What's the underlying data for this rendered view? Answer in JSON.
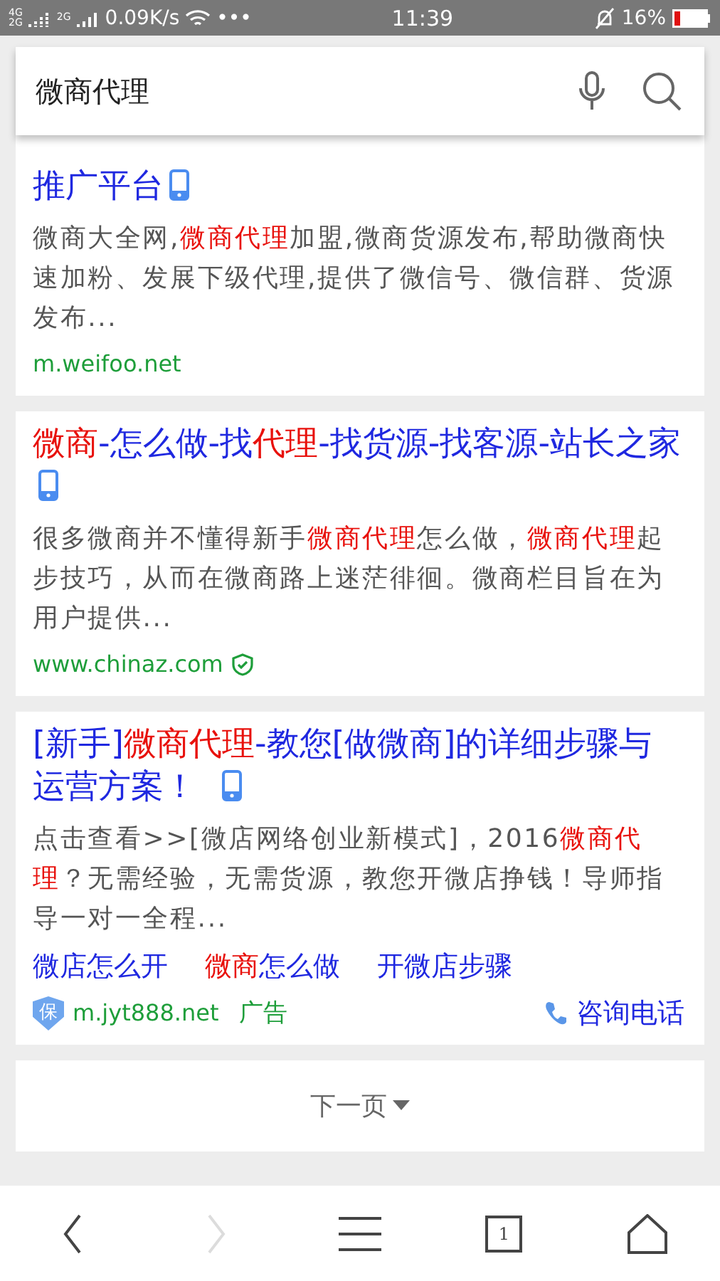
{
  "status_bar": {
    "sim_1_labels": [
      "4G",
      "2G"
    ],
    "sim_2_label": "2G",
    "speed": "0.09K/s",
    "more": "•••",
    "time": "11:39",
    "battery": "16%"
  },
  "search": {
    "value": "微商代理"
  },
  "results": [
    {
      "title": [
        {
          "text": "推广平台",
          "highlight": false
        }
      ],
      "mobile": true,
      "snippet": [
        {
          "text": "微商大全网,",
          "highlight": false
        },
        {
          "text": "微商代理",
          "highlight": true
        },
        {
          "text": "加盟,微商货源发布,帮助微商快速加粉、发展下级代理,提供了微信号、微信群、货源发布...",
          "highlight": false
        }
      ],
      "url": "m.weifoo.net",
      "verified": false
    },
    {
      "title": [
        {
          "text": "微商",
          "highlight": true
        },
        {
          "text": "-怎么做-找",
          "highlight": false
        },
        {
          "text": "代理",
          "highlight": true
        },
        {
          "text": "-找货源-找客源-站长之家",
          "highlight": false
        }
      ],
      "mobile": true,
      "snippet": [
        {
          "text": "很多微商并不懂得新手",
          "highlight": false
        },
        {
          "text": "微商代理",
          "highlight": true
        },
        {
          "text": "怎么做，",
          "highlight": false
        },
        {
          "text": "微商代理",
          "highlight": true
        },
        {
          "text": "起步技巧，从而在微商路上迷茫徘徊。微商栏目旨在为用户提供...",
          "highlight": false
        }
      ],
      "url": "www.chinaz.com",
      "verified": true
    },
    {
      "title": [
        {
          "text": "[新手]",
          "highlight": false
        },
        {
          "text": "微商代理",
          "highlight": true
        },
        {
          "text": "-教您[做微商]的详细步骤与运营方案！",
          "highlight": false
        }
      ],
      "mobile": true,
      "snippet": [
        {
          "text": "点击查看>>[微店网络创业新模式]，2016",
          "highlight": false
        },
        {
          "text": "微商代理",
          "highlight": true
        },
        {
          "text": "？无需经验，无需货源，教您开微店挣钱！导师指导一对一全程...",
          "highlight": false
        }
      ],
      "sitelinks": [
        [
          {
            "text": "微店怎么开",
            "highlight": false
          }
        ],
        [
          {
            "text": "微商",
            "highlight": true
          },
          {
            "text": "怎么做",
            "highlight": false
          }
        ],
        [
          {
            "text": "开微店步骤",
            "highlight": false
          }
        ]
      ],
      "badge": "保",
      "url": "m.jyt888.net",
      "verified": false,
      "ad_label": "广告",
      "call_label": "咨询电话"
    }
  ],
  "next_page": "下一页",
  "nav": [
    {
      "kind": "back",
      "disabled": false
    },
    {
      "kind": "forward",
      "disabled": true
    },
    {
      "kind": "menu",
      "disabled": false
    },
    {
      "kind": "tabs",
      "label": "1",
      "disabled": false
    },
    {
      "kind": "home",
      "disabled": false
    }
  ]
}
